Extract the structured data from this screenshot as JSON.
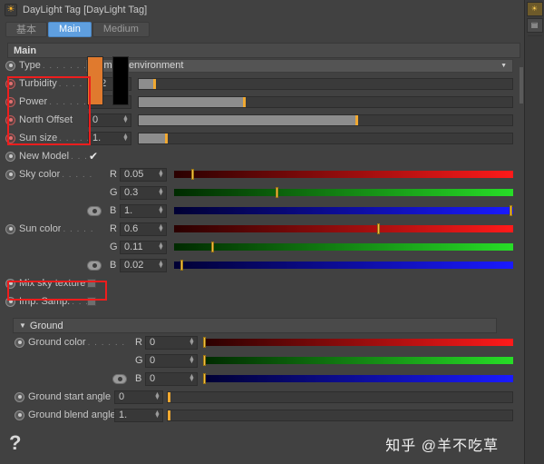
{
  "window": {
    "title": "DayLight Tag [DayLight Tag]",
    "icon": "sun-icon"
  },
  "tabs": [
    {
      "label": "基本",
      "active": false
    },
    {
      "label": "Main",
      "active": true
    },
    {
      "label": "Medium",
      "active": false
    }
  ],
  "sections": {
    "main_header": "Main",
    "ground_header": "Ground"
  },
  "main": {
    "type": {
      "label": "Type",
      "dots": ". . . . . . . . .",
      "value": "Primary environment"
    },
    "turbidity": {
      "label": "Turbidity",
      "dots": ". . . .",
      "value": "2.2",
      "fill_pct": 4,
      "handle_pct": 4
    },
    "power": {
      "label": "Power",
      "dots": ". . . . . . .",
      "value": "1.",
      "fill_pct": 28,
      "handle_pct": 28
    },
    "north_offset": {
      "label": "North Offset",
      "dots": "",
      "value": "0",
      "fill_pct": 58,
      "handle_pct": 58
    },
    "sun_size": {
      "label": "Sun size",
      "dots": ". . . . .",
      "value": "1.",
      "fill_pct": 7,
      "handle_pct": 7
    },
    "new_model": {
      "label": "New Model",
      "dots": ". . .",
      "checked": true,
      "check_glyph": "✔"
    },
    "sky_color": {
      "label": "Sky color",
      "dots": ". . . . .",
      "swatch": "#4a9ae8",
      "channels": [
        {
          "name": "R",
          "value": "0.05",
          "handle_pct": 5
        },
        {
          "name": "G",
          "value": "0.3",
          "handle_pct": 30
        },
        {
          "name": "B",
          "value": "1.",
          "handle_pct": 99
        }
      ]
    },
    "sun_color": {
      "label": "Sun color",
      "dots": ". . . . .",
      "swatch": "#e07a2e",
      "channels": [
        {
          "name": "R",
          "value": "0.6",
          "handle_pct": 60
        },
        {
          "name": "G",
          "value": "0.11",
          "handle_pct": 11
        },
        {
          "name": "B",
          "value": "0.02",
          "handle_pct": 2
        }
      ]
    },
    "mix_sky_texture": {
      "label": "Mix sky texture",
      "dots": "",
      "checked": false
    },
    "imp_samp": {
      "label": "Imp. Samp.",
      "dots": ". . . .",
      "checked": false
    }
  },
  "ground": {
    "ground_color": {
      "label": "Ground color",
      "dots": ". . . . . .",
      "swatch": "#000000",
      "channels": [
        {
          "name": "R",
          "value": "0",
          "handle_pct": 0
        },
        {
          "name": "G",
          "value": "0",
          "handle_pct": 0
        },
        {
          "name": "B",
          "value": "0",
          "handle_pct": 0
        }
      ]
    },
    "start_angle": {
      "label": "Ground start angle",
      "value": "0",
      "handle_pct": 0
    },
    "blend_angle": {
      "label": "Ground blend angle",
      "value": "1.",
      "handle_pct": 0
    }
  },
  "help": {
    "glyph": "?"
  },
  "watermark": {
    "text": "知乎 @羊不吃草"
  },
  "colors": {
    "panel_bg": "#414141",
    "accent_tab": "#5f9fe0",
    "slider_handle": "#f0a830",
    "highlight_box": "#ee1d1d"
  }
}
